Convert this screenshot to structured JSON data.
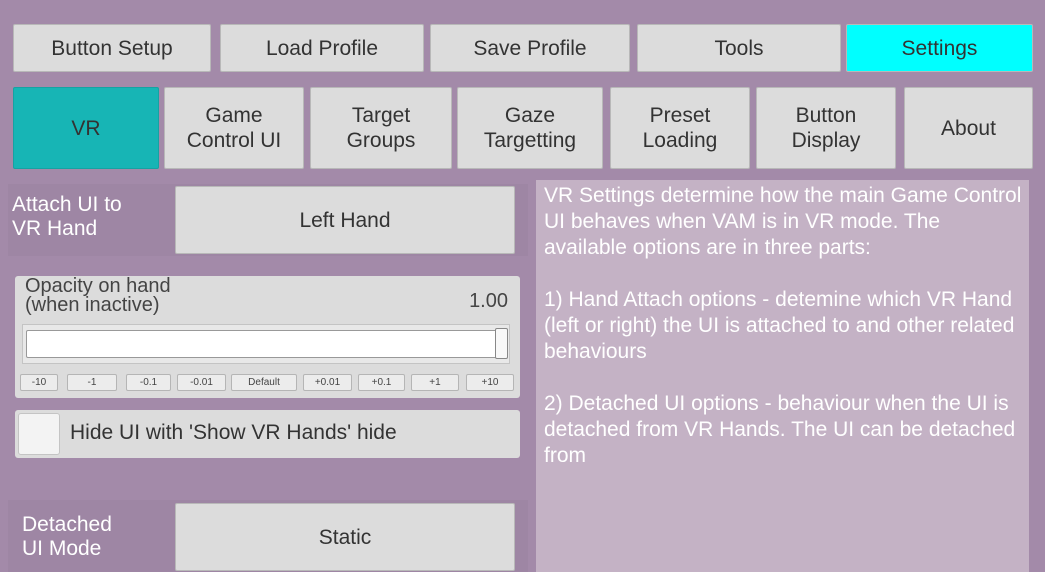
{
  "top_tabs": [
    {
      "label": "Button Setup"
    },
    {
      "label": "Load Profile"
    },
    {
      "label": "Save Profile"
    },
    {
      "label": "Tools"
    },
    {
      "label": "Settings"
    }
  ],
  "sub_tabs": [
    {
      "label": "VR"
    },
    {
      "label": "Game\nControl UI"
    },
    {
      "label": "Target\nGroups"
    },
    {
      "label": "Gaze\nTargetting"
    },
    {
      "label": "Preset\nLoading"
    },
    {
      "label": "Button\nDisplay"
    },
    {
      "label": "About"
    }
  ],
  "attach": {
    "label": "Attach UI to\nVR Hand",
    "value": "Left Hand"
  },
  "opacity": {
    "label": "Opacity on hand\n(when inactive)",
    "value": "1.00",
    "level": 1.0,
    "steps": [
      "-10",
      "-1",
      "-0.1",
      "-0.01",
      "Default",
      "+0.01",
      "+0.1",
      "+1",
      "+10"
    ]
  },
  "hide_toggle": {
    "label": "Hide UI with 'Show VR Hands' hide",
    "checked": false
  },
  "detached": {
    "label": "Detached\nUI Mode",
    "value": "Static"
  },
  "description": "VR Settings determine how the main Game Control UI behaves when VAM is in VR mode. The available options are in three parts:\n\n1) Hand Attach options - detemine which VR Hand (left or right) the UI is attached to and other related behaviours\n\n2) Detached UI options - behaviour when the UI is detached from VR Hands. The UI can be detached from"
}
